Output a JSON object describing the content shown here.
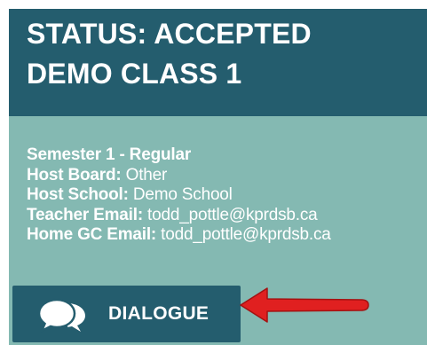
{
  "card": {
    "status": "STATUS: ACCEPTED",
    "class_name": "DEMO CLASS 1",
    "semester": "Semester 1 - Regular",
    "details": [
      {
        "label": "Host Board:",
        "value": " Other"
      },
      {
        "label": "Host School:",
        "value": " Demo School"
      },
      {
        "label": "Teacher Email:",
        "value": " todd_pottle@kprdsb.ca"
      },
      {
        "label": "Home GC Email:",
        "value": " todd_pottle@kprdsb.ca"
      }
    ]
  },
  "dialogue_button": {
    "label": "DIALOGUE",
    "icon": "chat-bubbles-icon"
  },
  "annotation": {
    "icon": "red-arrow-icon"
  },
  "colors": {
    "header_bg": "#245d6e",
    "card_bg": "#84b9b2",
    "button_bg": "#245d6e",
    "arrow": "#e02020",
    "text": "#ffffff"
  }
}
